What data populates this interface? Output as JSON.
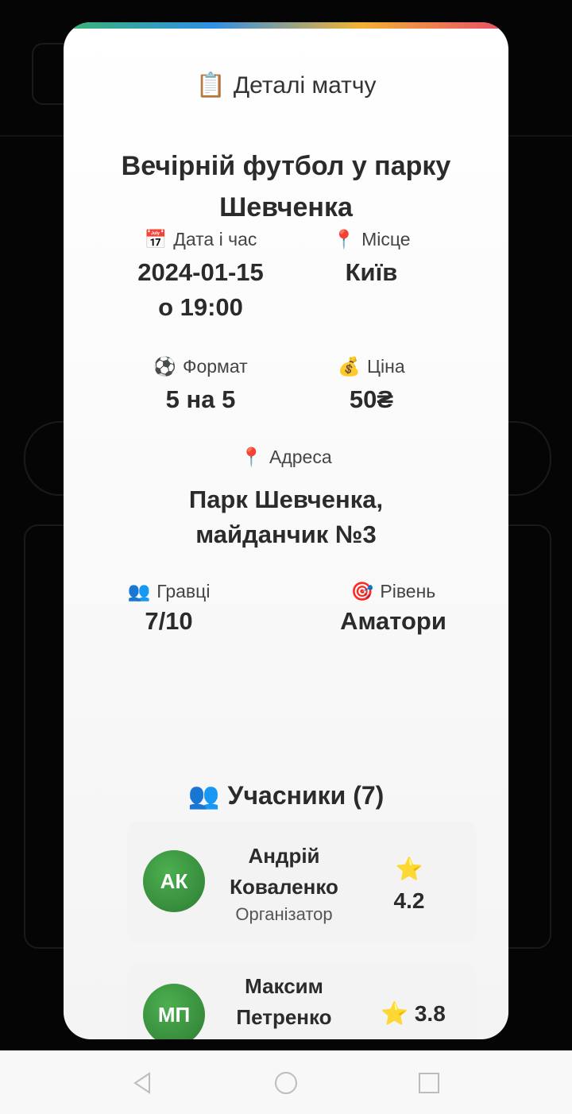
{
  "modal": {
    "header_icon": "clipboard-icon",
    "header_title": "Деталі матчу",
    "match_title": "Вечірній футбол у парку Шевченка",
    "info": {
      "date": {
        "icon": "calendar-icon",
        "label": "Дата і час",
        "value_line1": "2024-01-15",
        "value_line2": "о 19:00"
      },
      "place": {
        "icon": "pin-icon",
        "label": "Місце",
        "value": "Київ"
      },
      "format": {
        "icon": "soccer-ball-icon",
        "label": "Формат",
        "value": "5 на 5"
      },
      "price": {
        "icon": "money-bag-icon",
        "label": "Ціна",
        "value": "50₴"
      },
      "address": {
        "icon": "pin-icon",
        "label": "Адреса",
        "value_line1": "Парк Шевченка,",
        "value_line2": "майданчик №3"
      },
      "players": {
        "icon": "people-icon",
        "label": "Гравці",
        "value": "7/10"
      },
      "level": {
        "icon": "target-icon",
        "label": "Рівень",
        "value": "Аматори"
      }
    },
    "participants": {
      "icon": "people-icon",
      "title": "Учасники (7)",
      "items": [
        {
          "initials": "АК",
          "first_name": "Андрій",
          "last_name": "Коваленко",
          "role": "Організатор",
          "rating": "4.2"
        },
        {
          "initials": "МП",
          "first_name": "Максим",
          "last_name": "Петренко",
          "role": "",
          "rating": "3.8"
        }
      ]
    }
  },
  "colors": {
    "avatar_green": "#2e7d32",
    "gradient": [
      "#3cb371",
      "#2f8fe6",
      "#f2b233",
      "#e94b6a"
    ]
  }
}
